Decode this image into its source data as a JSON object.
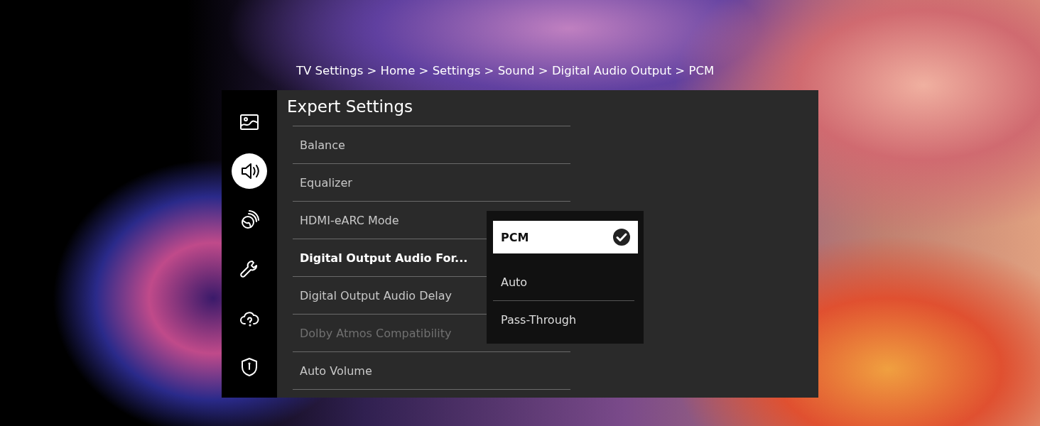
{
  "breadcrumb": "TV Settings > Home > Settings > Sound > Digital Audio Output > PCM",
  "sidebar": {
    "items": [
      {
        "selected": false
      },
      {
        "selected": true
      },
      {
        "selected": false
      },
      {
        "selected": false
      },
      {
        "selected": false
      },
      {
        "selected": false
      }
    ]
  },
  "panel": {
    "title": "Expert Settings",
    "items": [
      {
        "label": "Balance",
        "selected": false,
        "disabled": false
      },
      {
        "label": "Equalizer",
        "selected": false,
        "disabled": false
      },
      {
        "label": "HDMI-eARC Mode",
        "selected": false,
        "disabled": false
      },
      {
        "label": "Digital Output Audio For...",
        "selected": true,
        "disabled": false
      },
      {
        "label": "Digital Output Audio Delay",
        "selected": false,
        "disabled": false
      },
      {
        "label": "Dolby Atmos Compatibility",
        "selected": false,
        "disabled": true
      },
      {
        "label": "Auto Volume",
        "selected": false,
        "disabled": false
      }
    ]
  },
  "dropdown": {
    "options": [
      {
        "label": "PCM",
        "selected": true
      },
      {
        "label": "Auto",
        "selected": false
      },
      {
        "label": "Pass-Through",
        "selected": false
      }
    ]
  }
}
